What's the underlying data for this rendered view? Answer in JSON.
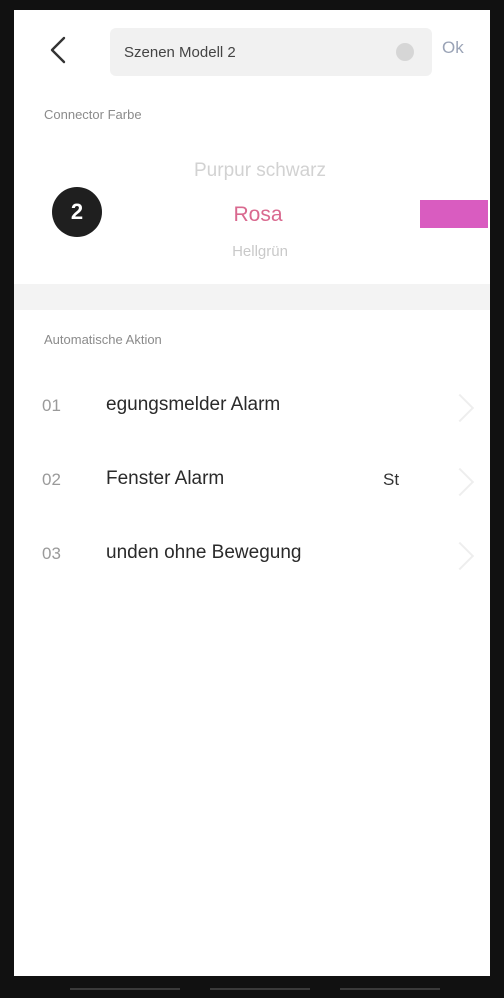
{
  "header": {
    "name_value": "Szenen Modell 2",
    "ok_label": "Ok"
  },
  "color_section": {
    "label": "Connector Farbe",
    "badge": "2",
    "colors": {
      "previous": "Purpur schwarz",
      "selected": "Rosa",
      "next": "Hellgrün"
    },
    "swatch_color": "#d95cc0"
  },
  "actions_section": {
    "label": "Automatische Aktion",
    "items": [
      {
        "number": "01",
        "label": "egungsmelder Alarm",
        "extra": ""
      },
      {
        "number": "02",
        "label": "Fenster Alarm",
        "extra": "St"
      },
      {
        "number": "03",
        "label": "unden ohne Bewegung",
        "extra": ""
      }
    ]
  }
}
